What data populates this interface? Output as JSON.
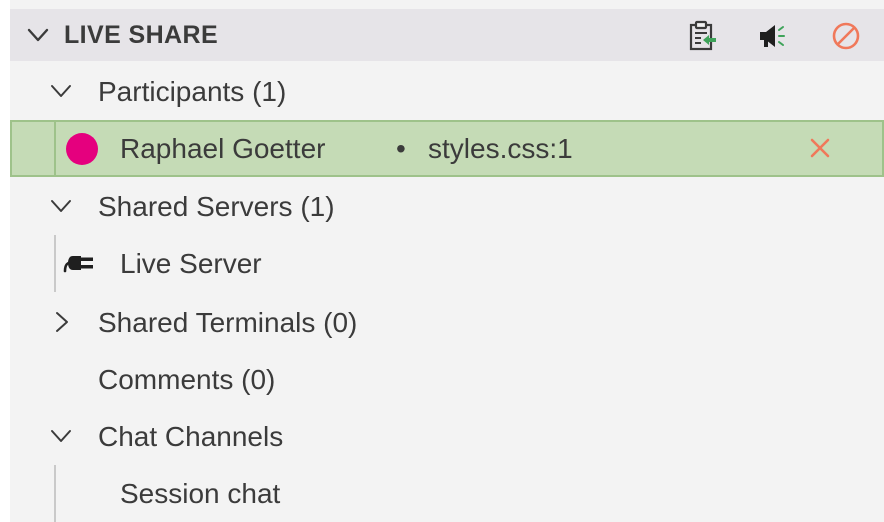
{
  "header": {
    "title": "LIVE SHARE",
    "icons": [
      "collapse-chevron-icon",
      "clipboard-export-icon",
      "megaphone-icon",
      "stop-sharing-icon"
    ]
  },
  "tree": {
    "participants": {
      "label": "Participants (1)",
      "expanded": true,
      "participant": {
        "name": "Raphael Goetter",
        "separator": "•",
        "location": "styles.css:1",
        "color": "#e5007e"
      }
    },
    "servers": {
      "label": "Shared Servers (1)",
      "expanded": true,
      "item": "Live Server"
    },
    "terminals": {
      "label": "Shared Terminals (0)",
      "expanded": false
    },
    "comments": {
      "label": "Comments (0)"
    },
    "chat": {
      "label": "Chat Channels",
      "expanded": true,
      "item": "Session chat"
    }
  },
  "colors": {
    "panel_bg": "#f3f3f3",
    "header_bg": "#e6e4e8",
    "selection_bg": "#c5dbb6",
    "selection_border": "#9ec28a",
    "close_color": "#f0785a",
    "stop_color": "#f0785a"
  }
}
